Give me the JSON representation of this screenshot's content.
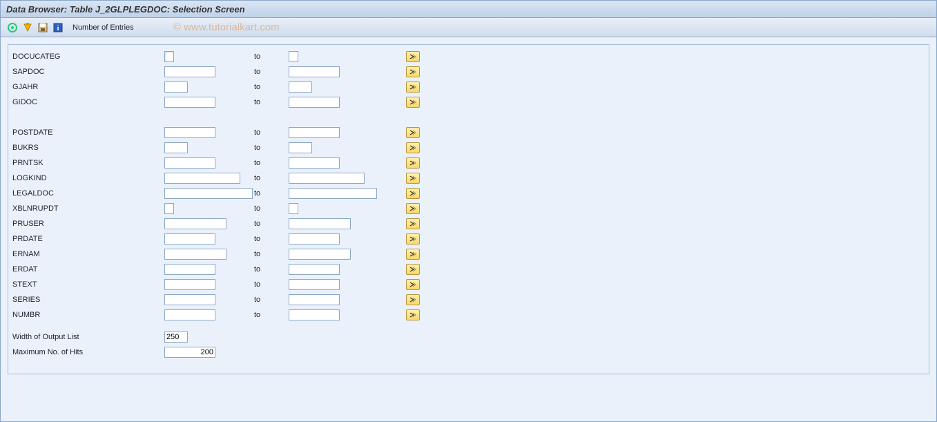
{
  "header": {
    "title": "Data Browser: Table J_2GLPLEGDOC: Selection Screen"
  },
  "toolbar": {
    "entries_label": "Number of Entries"
  },
  "watermark": "© www.tutorialkart.com",
  "labels": {
    "to": "to"
  },
  "group1": [
    {
      "name": "DOCUCATEG",
      "from_w": 14,
      "to_w": 14,
      "focus": true
    },
    {
      "name": "SAPDOC",
      "from_w": 74,
      "to_w": 74
    },
    {
      "name": "GJAHR",
      "from_w": 34,
      "to_w": 34
    },
    {
      "name": "GIDOC",
      "from_w": 74,
      "to_w": 74
    }
  ],
  "group2": [
    {
      "name": "POSTDATE",
      "from_w": 74,
      "to_w": 74
    },
    {
      "name": "BUKRS",
      "from_w": 34,
      "to_w": 34
    },
    {
      "name": "PRNTSK",
      "from_w": 74,
      "to_w": 74
    },
    {
      "name": "LOGKIND",
      "from_w": 110,
      "to_w": 110
    },
    {
      "name": "LEGALDOC",
      "from_w": 128,
      "to_w": 128
    },
    {
      "name": "XBLNRUPDT",
      "from_w": 14,
      "to_w": 14
    },
    {
      "name": "PRUSER",
      "from_w": 90,
      "to_w": 90
    },
    {
      "name": "PRDATE",
      "from_w": 74,
      "to_w": 74
    },
    {
      "name": "ERNAM",
      "from_w": 90,
      "to_w": 90
    },
    {
      "name": "ERDAT",
      "from_w": 74,
      "to_w": 74
    },
    {
      "name": "STEXT",
      "from_w": 74,
      "to_w": 74
    },
    {
      "name": "SERIES",
      "from_w": 74,
      "to_w": 74
    },
    {
      "name": "NUMBR",
      "from_w": 74,
      "to_w": 74
    }
  ],
  "bottom": {
    "width_label": "Width of Output List",
    "width_value": "250",
    "max_label": "Maximum No. of Hits",
    "max_value": "200"
  }
}
